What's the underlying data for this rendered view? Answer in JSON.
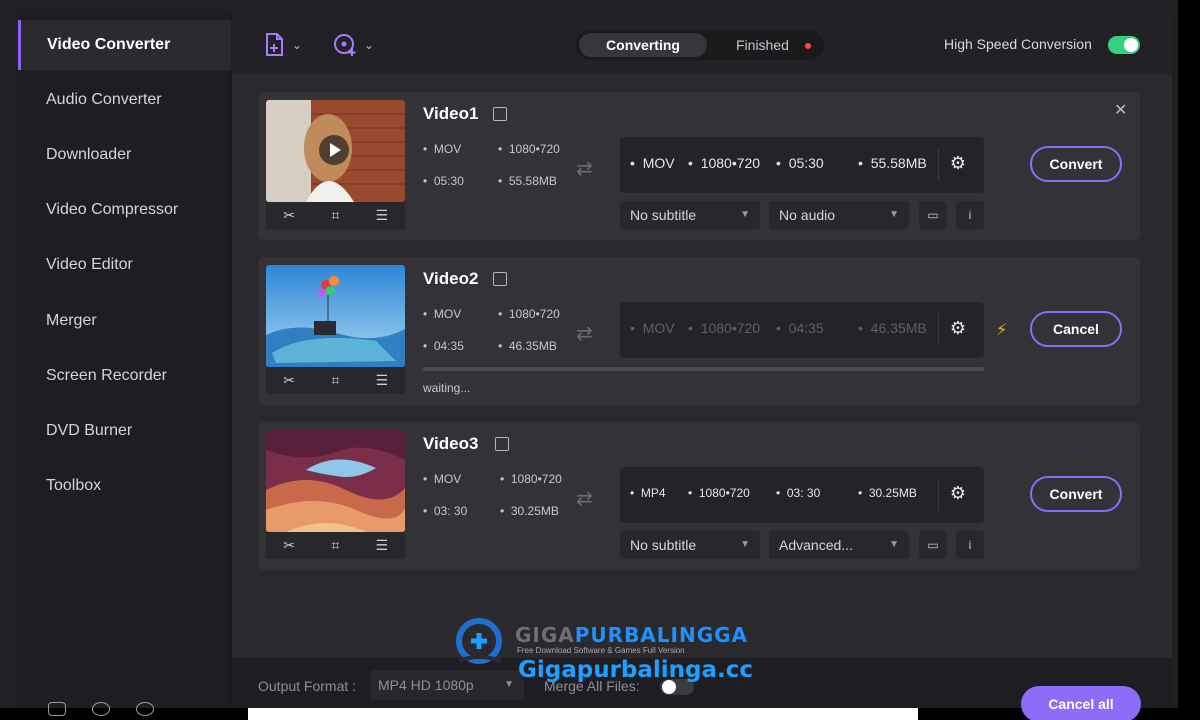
{
  "sidebar": {
    "items": [
      {
        "label": "Video Converter",
        "active": true
      },
      {
        "label": "Audio Converter"
      },
      {
        "label": "Downloader"
      },
      {
        "label": "Video Compressor"
      },
      {
        "label": "Video Editor"
      },
      {
        "label": "Merger"
      },
      {
        "label": "Screen Recorder"
      },
      {
        "label": "DVD Burner"
      },
      {
        "label": "Toolbox"
      }
    ]
  },
  "header": {
    "tab_converting": "Converting",
    "tab_finished": "Finished",
    "high_speed_label": "High Speed Conversion",
    "high_speed_on": true
  },
  "videos": [
    {
      "title": "Video1",
      "src_format": "MOV",
      "src_res": "1080•720",
      "src_duration": "05:30",
      "src_size": "55.58MB",
      "out_format": "MOV",
      "out_res": "1080•720",
      "out_duration": "05:30",
      "out_size": "55.58MB",
      "subtitle": "No subtitle",
      "audio": "No audio",
      "action": "Convert"
    },
    {
      "title": "Video2",
      "src_format": "MOV",
      "src_res": "1080•720",
      "src_duration": "04:35",
      "src_size": "46.35MB",
      "out_format": "MOV",
      "out_res": "1080•720",
      "out_duration": "04:35",
      "out_size": "46.35MB",
      "status": "waiting...",
      "progress": 0,
      "action": "Cancel"
    },
    {
      "title": "Video3",
      "src_format": "MOV",
      "src_res": "1080•720",
      "src_duration": "03: 30",
      "src_size": "30.25MB",
      "out_format": "MP4",
      "out_res": "1080•720",
      "out_duration": "03: 30",
      "out_size": "30.25MB",
      "subtitle": "No subtitle",
      "audio": "Advanced...",
      "action": "Convert"
    }
  ],
  "footer": {
    "output_format_label": "Output Format :",
    "output_format_value": "MP4 HD 1080p",
    "merge_label": "Merge All Files:",
    "merge_on": false,
    "cancel_all": "Cancel all"
  },
  "watermark": {
    "brand_a": "GIGA",
    "brand_b": "PURBALINGGA",
    "tagline": "Free Download Software & Games Full Version",
    "url": "Gigapurbalinga.cc"
  },
  "colors": {
    "accent": "#8e6cf7",
    "toggle_on": "#35d07f",
    "notify_dot": "#ff4a3d",
    "bolt": "#f0b429"
  },
  "icons": {
    "add_file": "add-file-icon",
    "add_dvd": "add-dvd-icon",
    "cut": "scissors-icon",
    "crop": "crop-icon",
    "effects": "sliders-icon",
    "settings": "gear-icon",
    "edit": "edit-icon",
    "close": "close-icon",
    "play": "play-icon",
    "shuffle": "shuffle-icon",
    "subtitle_track": "subtitle-track-icon",
    "info": "info-icon",
    "bolt": "lightning-icon"
  }
}
